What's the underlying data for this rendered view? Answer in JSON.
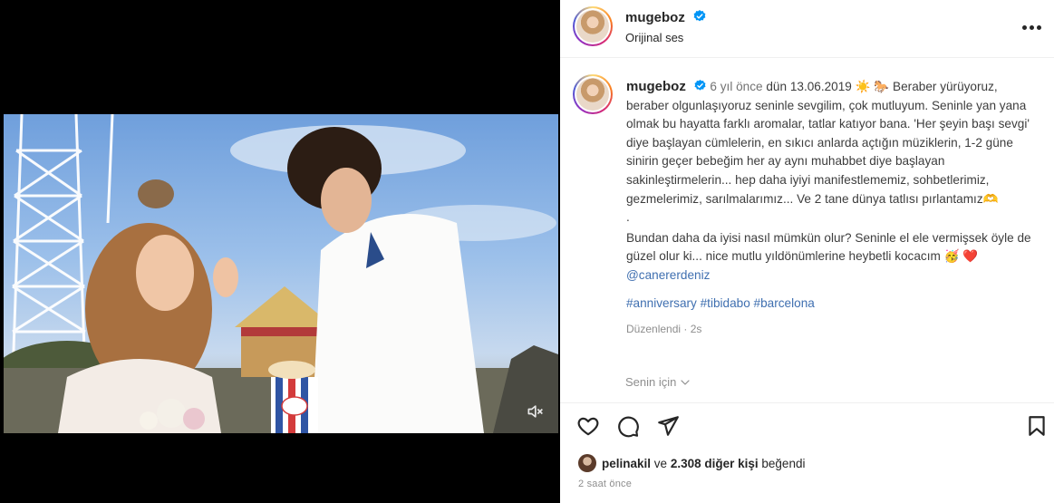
{
  "post": {
    "username": "mugeboz",
    "audio": "Orijinal ses",
    "caption": {
      "time": "6 yıl önce",
      "line1": "dün 13.06.2019 ☀️ 🐎 Beraber yürüyoruz, beraber olgunlaşıyoruz seninle sevgilim, çok mutluyum. Seninle yan yana olmak bu hayatta farklı aromalar, tatlar katıyor bana. 'Her şeyin başı sevgi' diye başlayan cümlelerin, en sıkıcı anlarda açtığın müziklerin, 1-2 güne sinirin geçer bebeğim her ay aynı muhabbet diye başlayan sakinleştirmelerin... hep daha iyiyi manifestlememiz, sohbetlerimiz, gezmelerimiz, sarılmalarımız... Ve 2 tane dünya tatlısı pırlantamız🫶",
      "dot": ".",
      "line2": "Bundan daha da iyisi nasıl mümkün olur? Seninle el ele vermişsek öyle de güzel olur ki... nice mutlu yıldönümlerine heybetli kocacım 🥳 ❤️",
      "mention": "@canererdeniz"
    },
    "hashtags": "#anniversary #tibidabo #barcelona",
    "edited": "Düzenlendi · 2s",
    "for_you": "Senin için",
    "likes": {
      "first_user": "pelinakil",
      "joiner": "ve",
      "count": "2.308 diğer kişi",
      "suffix": "beğendi"
    },
    "posted_ago": "2 saat önce"
  },
  "icons": {
    "verified": "verified-badge-icon",
    "more": "more-options-icon",
    "like": "heart-icon",
    "comment": "comment-icon",
    "share": "paper-plane-icon",
    "save": "bookmark-icon",
    "mute": "speaker-muted-icon",
    "chevron": "chevron-down-icon"
  },
  "colors": {
    "verified": "#0095f6",
    "link": "#3f6fb0",
    "muted_text": "#8e8e8e"
  }
}
